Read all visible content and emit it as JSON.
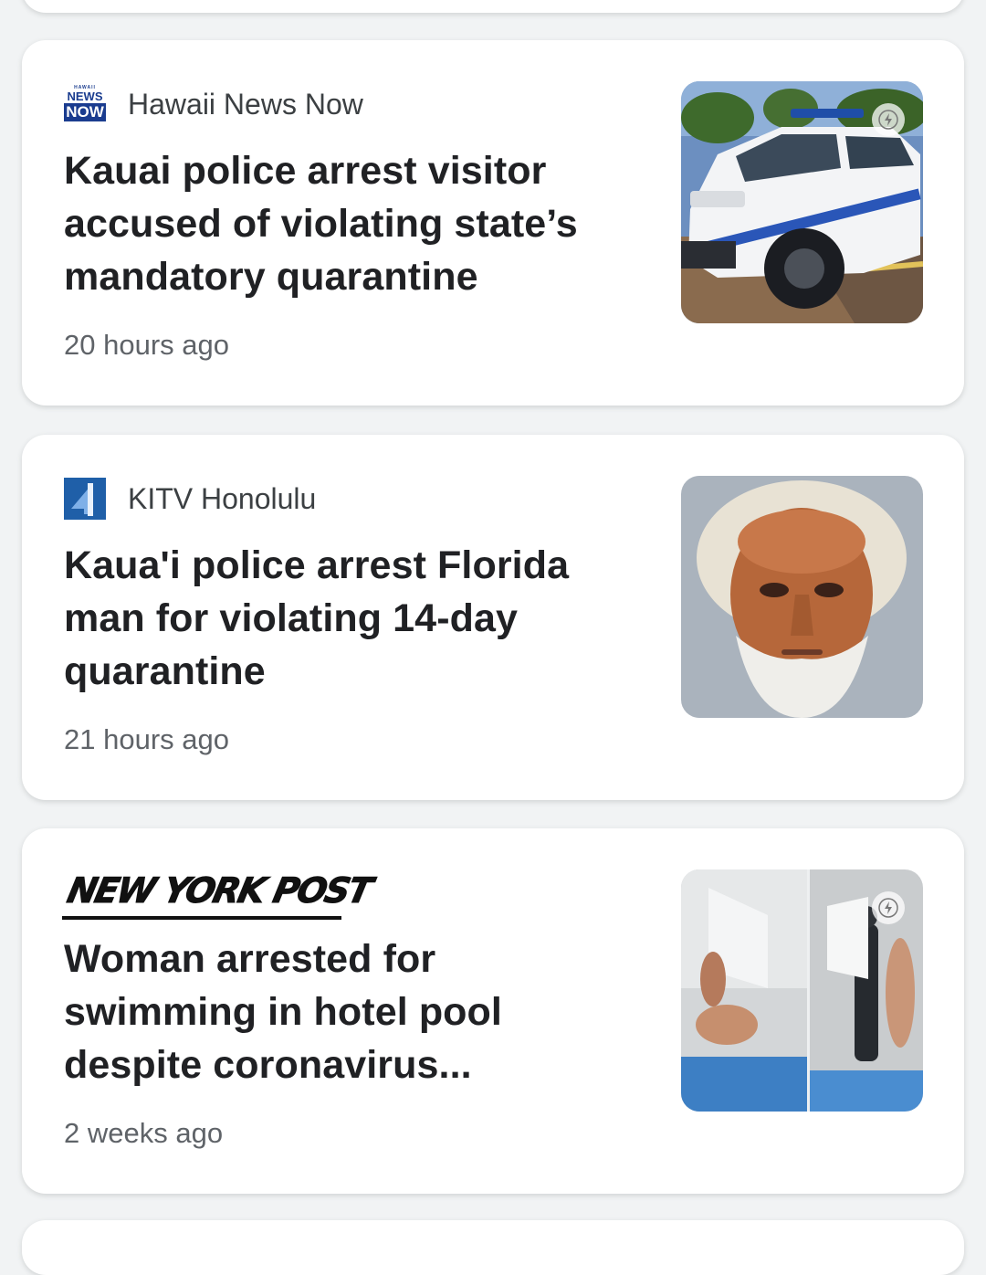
{
  "articles": [
    {
      "source": "Hawaii News Now",
      "logo": {
        "icon": "hawaii-news-now-logo",
        "small": "HAWAII",
        "line1": "NEWS",
        "line2": "NOW"
      },
      "headline": "Kauai police arrest visitor accused of violating state’s mandatory quarantine",
      "time": "20 hours ago",
      "thumbnail": "police-car-image",
      "amp": true
    },
    {
      "source": "KITV Honolulu",
      "logo": {
        "icon": "kitv-4-logo"
      },
      "headline": "Kaua'i police arrest Florida man for violating 14-day quarantine",
      "time": "21 hours ago",
      "thumbnail": "mugshot-image",
      "amp": false
    },
    {
      "source": "NEW YORK POST",
      "logo": {
        "icon": "new-york-post-logo"
      },
      "headline": "Woman arrested for swimming in hotel pool despite coronavirus...",
      "time": "2 weeks ago",
      "thumbnail": "hotel-pool-arrest-image",
      "amp": true
    }
  ],
  "colors": {
    "background": "#f1f3f4",
    "card": "#ffffff",
    "headline": "#202124",
    "meta": "#5f6368",
    "hnn_blue": "#1a3c8f",
    "kitv_blue": "#1f5fa8"
  }
}
